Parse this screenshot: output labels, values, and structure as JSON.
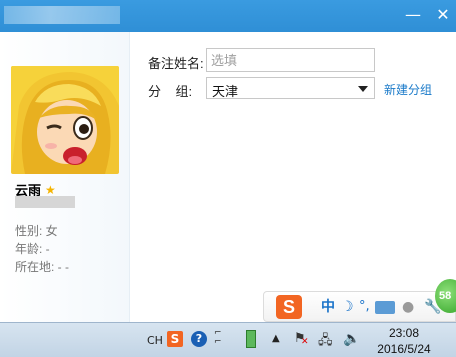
{
  "window": {
    "minimize_icon": "minimize-icon",
    "close_icon": "close-icon"
  },
  "profile": {
    "name": "云雨",
    "star_icon": "star-icon",
    "gender": "性别: 女",
    "age": "年龄: -",
    "location": "所在地: -   -"
  },
  "form": {
    "remark_label": "备注姓名:",
    "remark_placeholder": "选填",
    "remark_value": "",
    "group_label": "分    组:",
    "group_value": "天津",
    "new_group_link": "新建分组"
  },
  "ime": {
    "logo": "S",
    "mode": "中",
    "halfwidth_icon": "moon-icon",
    "punct": "°,",
    "keyboard_icon": "keyboard-icon",
    "user_icon": "user-icon",
    "tools_icon": "wrench-icon",
    "badge": "58"
  },
  "taskbar": {
    "lang": "CH",
    "sogou_icon": "S",
    "help_icon": "?",
    "time": "23:08",
    "date": "2016/5/24"
  },
  "colors": {
    "titlebar": "#2f8fd6",
    "link": "#1a7ac9",
    "star": "#f5b400",
    "sogou": "#f26522"
  }
}
